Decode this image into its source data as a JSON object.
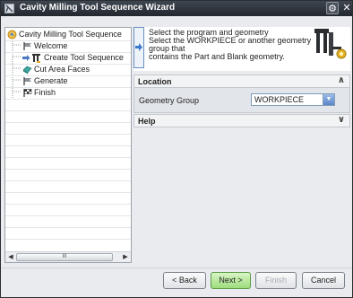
{
  "window": {
    "title": "Cavity Milling Tool Sequence Wizard"
  },
  "tree": {
    "root_label": "Cavity Milling Tool Sequence",
    "items": [
      {
        "label": "Welcome"
      },
      {
        "label": "Create Tool Sequence"
      },
      {
        "label": "Cut Area Faces"
      },
      {
        "label": "Generate"
      },
      {
        "label": "Finish"
      }
    ],
    "scroll_thumb": "III"
  },
  "message": {
    "lines": [
      "Select the program and geometry",
      "Select the WORKPIECE or another geometry",
      "group that",
      "contains the Part and Blank geometry."
    ]
  },
  "location": {
    "title": "Location",
    "field_label": "Geometry Group",
    "field_value": "WORKPIECE"
  },
  "help": {
    "title": "Help"
  },
  "buttons": {
    "back": "< Back",
    "next": "Next >",
    "finish": "Finish",
    "cancel": "Cancel"
  }
}
